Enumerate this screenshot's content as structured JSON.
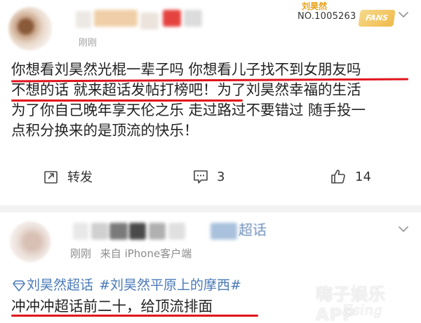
{
  "post1": {
    "time": "刚刚",
    "badge": {
      "name": "刘昊然",
      "number": "NO.1005263",
      "fans_label": "FANS"
    },
    "content_lines": [
      "你想看刘昊然光棍一辈子吗 你想看儿子找不到女朋友吗",
      "不想的话 就来超话发帖打榜吧！为了刘昊然幸福的生活",
      "为了你自己晚年享天伦之乐 走过路过不要错过 随手投一",
      "点积分换来的是顶流的快乐！"
    ],
    "actions": {
      "repost_label": "转发",
      "comment_count": "3",
      "like_count": "14"
    }
  },
  "post2": {
    "username_suffix": "超话",
    "time": "刚刚",
    "source": "来自 iPhone客户端",
    "tags": [
      "刘昊然超话",
      "#刘昊然平原上的摩西#"
    ],
    "content": "冲冲冲超话前二十，给顶流排面"
  },
  "watermark": {
    "text": "嗨子娱乐APP",
    "sub": "Esing"
  },
  "colors": {
    "accent_red": "#e0131c",
    "link_blue": "#4a7ab8",
    "badge_gold": "#e8a015"
  },
  "icons": {
    "repost": "repost-icon",
    "comment": "comment-icon",
    "like": "thumbs-up-icon",
    "more": "chevron-down-icon",
    "super_topic": "diamond-icon"
  }
}
